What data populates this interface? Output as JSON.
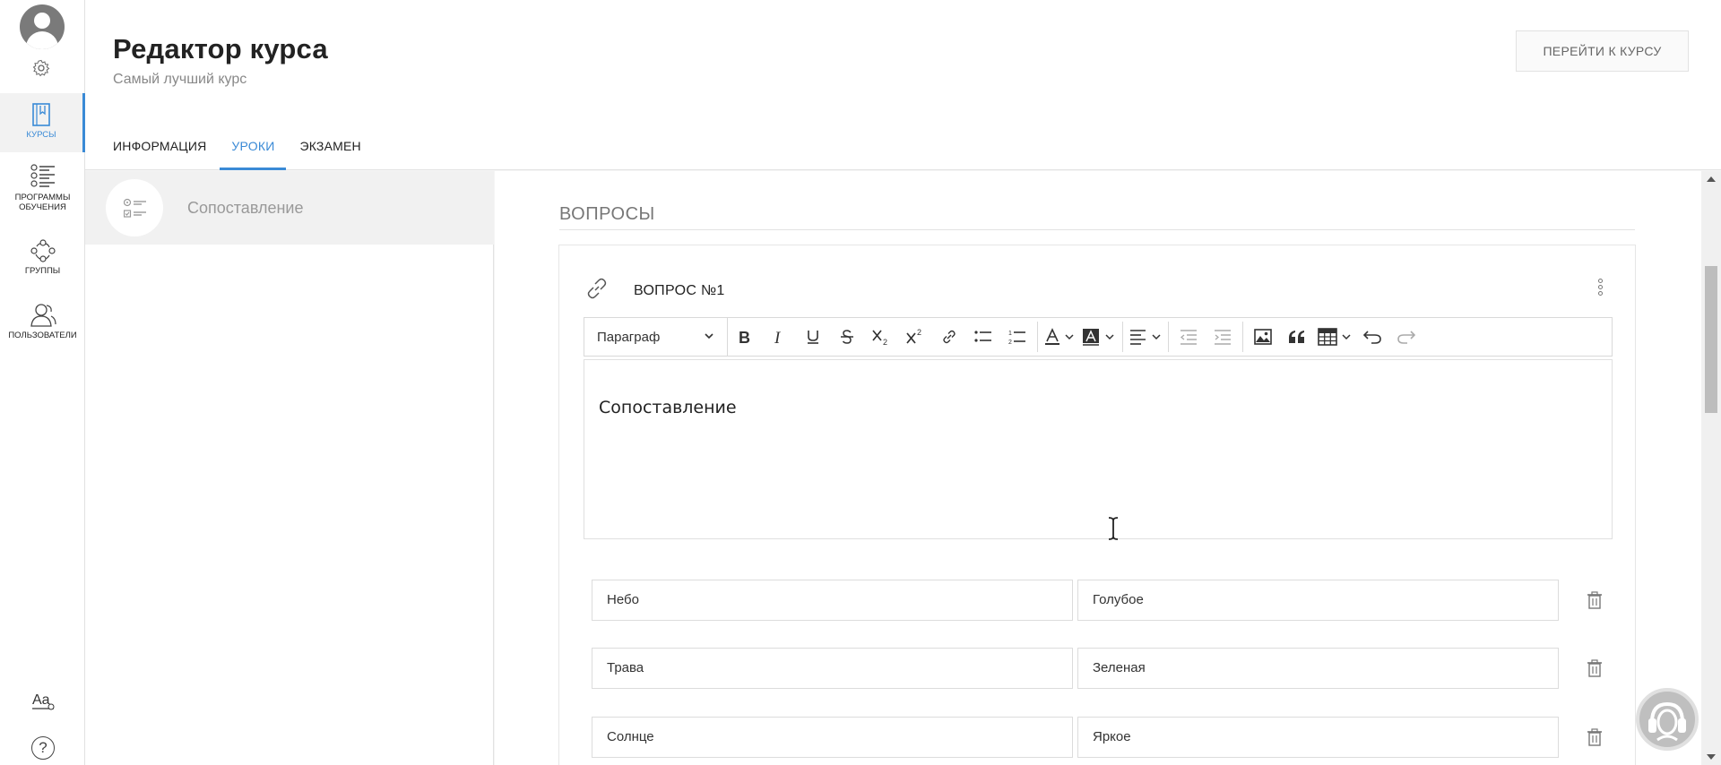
{
  "nav": {
    "items": [
      {
        "label": "КУРСЫ",
        "icon": "course-book-icon",
        "active": true
      },
      {
        "label": "ПРОГРАММЫ ОБУЧЕНИЯ",
        "icon": "programs-list-icon"
      },
      {
        "label": "ГРУППЫ",
        "icon": "groups-icon"
      },
      {
        "label": "ПОЛЬЗОВАТЕЛИ",
        "icon": "users-icon"
      }
    ],
    "bottom_icons": [
      "font-size-icon",
      "help-icon"
    ],
    "help_glyph": "?"
  },
  "header": {
    "title": "Редактор курса",
    "subtitle": "Самый лучший курс",
    "goto_button": "ПЕРЕЙТИ К КУРСУ",
    "tabs": [
      {
        "label": "ИНФОРМАЦИЯ"
      },
      {
        "label": "УРОКИ",
        "active": true
      },
      {
        "label": "ЭКЗАМЕН"
      }
    ]
  },
  "lessons": [
    {
      "title": "Сопоставление",
      "icon": "matching-list-icon"
    }
  ],
  "main": {
    "section_title": "ВОПРОСЫ",
    "question": {
      "title": "ВОПРОС №1",
      "toolbar": {
        "paragraph_select": "Параграф",
        "buttons": [
          "bold",
          "italic",
          "underline",
          "strikethrough",
          "subscript",
          "superscript",
          "link",
          "bulleted-list",
          "numbered-list",
          "font-color",
          "background-color",
          "align",
          "outdent",
          "indent",
          "insert-image",
          "blockquote",
          "insert-table",
          "undo",
          "redo"
        ]
      },
      "editor_text": "Сопоставление",
      "pairs": [
        {
          "left": "Небо",
          "right": "Голубое"
        },
        {
          "left": "Трава",
          "right": "Зеленая"
        },
        {
          "left": "Солнце",
          "right": "Яркое"
        }
      ]
    }
  },
  "colors": {
    "accent": "#3a8ad6",
    "nav_active_bg": "#f2f2f2",
    "border": "#e2e2e2"
  }
}
